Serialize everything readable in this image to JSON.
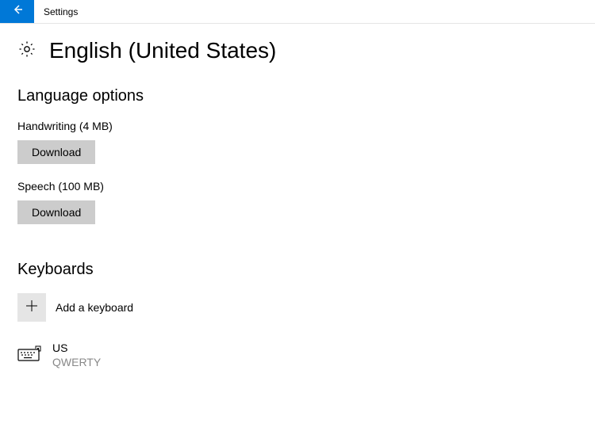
{
  "titleBar": {
    "appName": "Settings"
  },
  "page": {
    "title": "English (United States)"
  },
  "languageOptions": {
    "heading": "Language options",
    "items": [
      {
        "label": "Handwriting (4 MB)",
        "buttonLabel": "Download"
      },
      {
        "label": "Speech (100 MB)",
        "buttonLabel": "Download"
      }
    ]
  },
  "keyboards": {
    "heading": "Keyboards",
    "addLabel": "Add a keyboard",
    "items": [
      {
        "name": "US",
        "layout": "QWERTY"
      }
    ]
  }
}
